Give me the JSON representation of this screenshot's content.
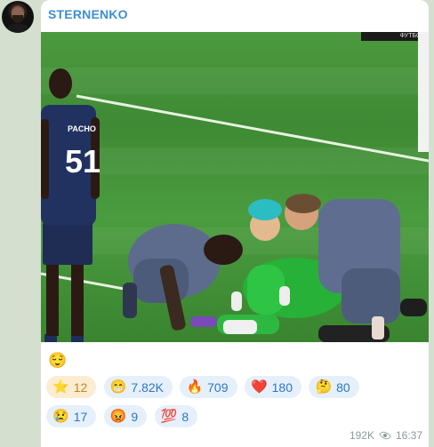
{
  "channel": {
    "name": "STERNENKO"
  },
  "media": {
    "tv_logo_text": "ФУТБОЛ",
    "player_number": "51",
    "player_name": "PACHO"
  },
  "message": {
    "caption_emoji": "😌"
  },
  "reactions": [
    {
      "emoji": "⭐",
      "count": "12",
      "paid": true
    },
    {
      "emoji": "😁",
      "count": "7.82K",
      "paid": false
    },
    {
      "emoji": "🔥",
      "count": "709",
      "paid": false
    },
    {
      "emoji": "❤️",
      "count": "180",
      "paid": false
    },
    {
      "emoji": "🤔",
      "count": "80",
      "paid": false
    },
    {
      "emoji": "😢",
      "count": "17",
      "paid": false
    },
    {
      "emoji": "😡",
      "count": "9",
      "paid": false
    },
    {
      "emoji": "💯",
      "count": "8",
      "paid": false
    }
  ],
  "meta": {
    "views": "192K",
    "time": "16:37"
  }
}
